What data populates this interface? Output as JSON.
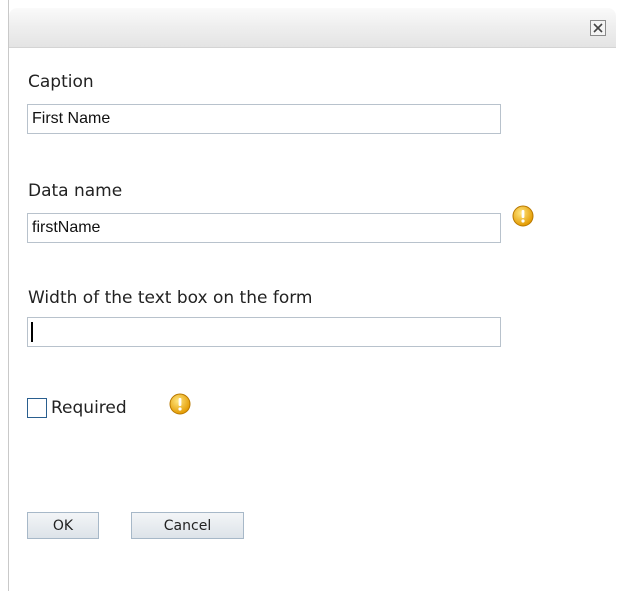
{
  "dialog": {
    "close_icon": "close-icon"
  },
  "fields": {
    "caption": {
      "label": "Caption",
      "value": "First Name"
    },
    "data_name": {
      "label": "Data name",
      "value": "firstName",
      "info_icon": "info-icon"
    },
    "width": {
      "label": "Width of the text box on the form",
      "value": ""
    },
    "required": {
      "label": "Required",
      "checked": false,
      "info_icon": "info-icon"
    }
  },
  "buttons": {
    "ok_label": "OK",
    "cancel_label": "Cancel"
  },
  "colors": {
    "info_icon_fill": "#f0b21a",
    "checkbox_border": "#2a5f8f",
    "input_border": "#b8c2cc"
  }
}
